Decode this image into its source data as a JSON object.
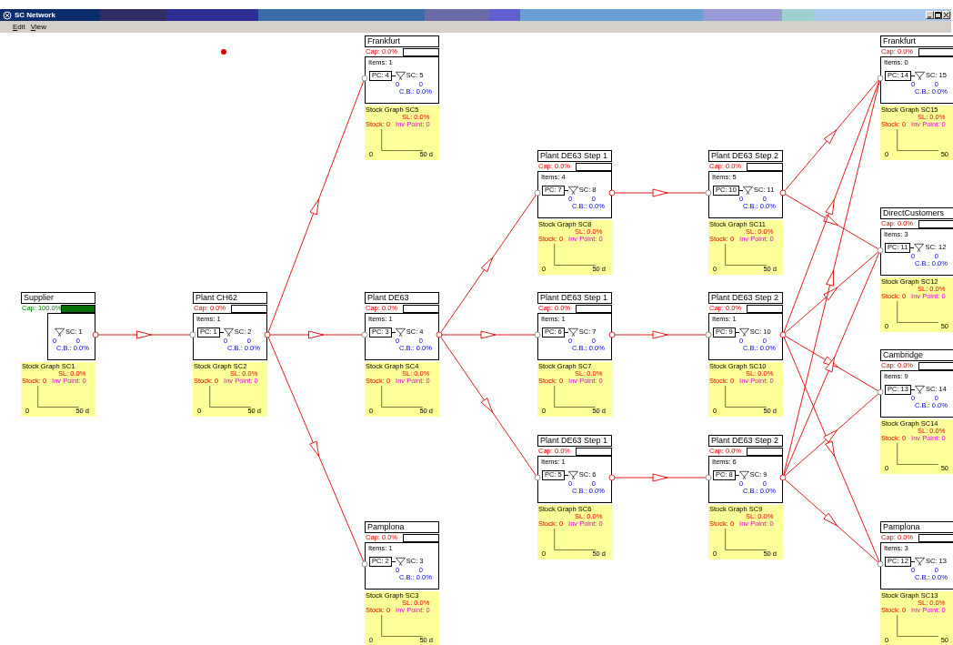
{
  "window": {
    "title": "SC Network"
  },
  "menu": [
    "Edit",
    "View"
  ],
  "nodes": [
    {
      "kind": "source",
      "title": "Supplier",
      "capacity": {
        "text": "Cap: 100.0%",
        "level": 1
      },
      "sc": "SC: 1",
      "sc_low": [
        "0",
        "0"
      ],
      "cbl": "C.B.: 0.0%",
      "graph": {
        "title": "Stock Graph SC1",
        "sl": "SL: 0.0%",
        "stock": "Stock: 0",
        "inv_point": "Inv Point: 0",
        "axis_min": "0",
        "axis_max": "50 d"
      }
    },
    {
      "kind": "site",
      "title": "Plant CH62",
      "capacity": {
        "text": "Cap: 0.0%",
        "level": 0
      },
      "items": "Items: 1",
      "pc": "PC: 1",
      "sc": "SC: 2",
      "sc_low": [
        "0",
        "0"
      ],
      "cbl": "C.B.: 0.0%",
      "graph": {
        "title": "Stock Graph SC2",
        "sl": "SL: 0.0%",
        "stock": "Stock: 0",
        "inv_point": "Inv Point: 0",
        "axis_min": "0",
        "axis_max": "50 d"
      }
    },
    {
      "kind": "site",
      "title": "Frankfurt",
      "capacity": {
        "text": "Cap: 0.0%",
        "level": 0
      },
      "items": "Items: 1",
      "pc": "PC: 4",
      "sc": "SC: 5",
      "sc_low": [
        "0",
        "0"
      ],
      "cbl": "C.B.: 0.0%",
      "graph": {
        "title": "Stock Graph SC5",
        "sl": "SL: 0.0%",
        "stock": "Stock: 0",
        "inv_point": "Inv Point: 0",
        "axis_min": "0",
        "axis_max": "50 d"
      }
    },
    {
      "kind": "site",
      "title": "Plant DE63",
      "capacity": {
        "text": "Cap: 0.0%",
        "level": 0
      },
      "items": "Items: 1",
      "pc": "PC: 3",
      "sc": "SC: 4",
      "sc_low": [
        "0",
        "0"
      ],
      "cbl": "C.B.: 0.0%",
      "graph": {
        "title": "Stock Graph SC4",
        "sl": "SL: 0.0%",
        "stock": "Stock: 0",
        "inv_point": "Inv Point: 0",
        "axis_min": "0",
        "axis_max": "50 d"
      }
    },
    {
      "kind": "site",
      "title": "Pamplona",
      "capacity": {
        "text": "Cap: 0.0%",
        "level": 0
      },
      "items": "Items: 1",
      "pc": "PC: 2",
      "sc": "SC: 3",
      "sc_low": [
        "0",
        "0"
      ],
      "cbl": "C.B.: 0.0%",
      "graph": {
        "title": "Stock Graph SC3",
        "sl": "SL: 0.0%",
        "stock": "Stock: 0",
        "inv_point": "Inv Point: 0",
        "axis_min": "0",
        "axis_max": "50 d"
      }
    },
    {
      "kind": "site",
      "title": "Plant DE63 Step 1",
      "capacity": {
        "text": "Cap: 0.0%",
        "level": 0
      },
      "items": "Items: 4",
      "pc": "PC: 7",
      "sc": "SC: 8",
      "sc_low": [
        "0",
        "0"
      ],
      "cbl": "C.B.: 0.0%",
      "graph": {
        "title": "Stock Graph SC8",
        "sl": "SL: 0.0%",
        "stock": "Stock: 0",
        "inv_point": "Inv Point: 0",
        "axis_min": "0",
        "axis_max": "50 d"
      }
    },
    {
      "kind": "site",
      "title": "Plant DE63 Step 1",
      "capacity": {
        "text": "Cap: 0.0%",
        "level": 0
      },
      "items": "Items: 1",
      "pc": "PC: 6",
      "sc": "SC: 7",
      "sc_low": [
        "0",
        "0"
      ],
      "cbl": "C.B.: 0.0%",
      "graph": {
        "title": "Stock Graph SC7",
        "sl": "SL: 0.0%",
        "stock": "Stock: 0",
        "inv_point": "Inv Point: 0",
        "axis_min": "0",
        "axis_max": "50 d"
      }
    },
    {
      "kind": "site",
      "title": "Plant DE63 Step 1",
      "capacity": {
        "text": "Cap: 0.0%",
        "level": 0
      },
      "items": "Items: 1",
      "pc": "PC: 5",
      "sc": "SC: 6",
      "sc_low": [
        "0",
        "0"
      ],
      "cbl": "C.B.: 0.0%",
      "graph": {
        "title": "Stock Graph SC6",
        "sl": "SL: 0.0%",
        "stock": "Stock: 0",
        "inv_point": "Inv Point: 0",
        "axis_min": "0",
        "axis_max": "50 d"
      }
    },
    {
      "kind": "site",
      "title": "Plant DE63 Step 2",
      "capacity": {
        "text": "Cap: 0.0%",
        "level": 0
      },
      "items": "Items: 5",
      "pc": "PC: 10",
      "sc": "SC: 11",
      "sc_low": [
        "0",
        "0"
      ],
      "cbl": "C.B.: 0.0%",
      "graph": {
        "title": "Stock Graph SC11",
        "sl": "SL: 0.0%",
        "stock": "Stock: 0",
        "inv_point": "Inv Point: 0",
        "axis_min": "0",
        "axis_max": "50 d"
      }
    },
    {
      "kind": "site",
      "title": "Plant DE63 Step 2",
      "capacity": {
        "text": "Cap: 0.0%",
        "level": 0
      },
      "items": "Items: 1",
      "pc": "PC: 9",
      "sc": "SC: 10",
      "sc_low": [
        "0",
        "0"
      ],
      "cbl": "C.B.: 0.0%",
      "graph": {
        "title": "Stock Graph SC10",
        "sl": "SL: 0.0%",
        "stock": "Stock: 0",
        "inv_point": "Inv Point: 0",
        "axis_min": "0",
        "axis_max": "50 d"
      }
    },
    {
      "kind": "site",
      "title": "Plant DE63 Step 2",
      "capacity": {
        "text": "Cap: 0.0%",
        "level": 0
      },
      "items": "Items: 6",
      "pc": "PC: 8",
      "sc": "SC: 9",
      "sc_low": [
        "0",
        "0"
      ],
      "cbl": "C.B.: 0.0%",
      "graph": {
        "title": "Stock Graph SC9",
        "sl": "SL: 0.0%",
        "stock": "Stock: 0",
        "inv_point": "Inv Point: 0",
        "axis_min": "0",
        "axis_max": "50 d"
      }
    },
    {
      "kind": "site",
      "title": "Frankfurt",
      "capacity": {
        "text": "Cap: 0.0%",
        "level": 0
      },
      "items": "Items: 0",
      "pc": "PC: 14",
      "sc": "SC: 15",
      "sc_low": [
        "0",
        "0"
      ],
      "cbl": "C.B.: 0.0%",
      "graph": {
        "title": "Stock Graph SC15",
        "sl": "SL: 0.0%",
        "stock": "Stock: 0",
        "inv_point": "Inv Point: 0",
        "axis_min": "0",
        "axis_max": "50"
      }
    },
    {
      "kind": "site",
      "title": "DirectCustomers",
      "capacity": {
        "text": "Cap: 0.0%",
        "level": 0
      },
      "items": "Items: 3",
      "pc": "PC: 11",
      "sc": "SC: 12",
      "sc_low": [
        "0",
        "0"
      ],
      "cbl": "C.B.: 0.0%",
      "graph": {
        "title": "Stock Graph SC12",
        "sl": "SL: 0.0%",
        "stock": "Stock: 0",
        "inv_point": "Inv Point: 0",
        "axis_min": "0",
        "axis_max": "50"
      }
    },
    {
      "kind": "site",
      "title": "Cambridge",
      "capacity": {
        "text": "Cap: 0.0%",
        "level": 0
      },
      "items": "Items: 9",
      "pc": "PC: 13",
      "sc": "SC: 14",
      "sc_low": [
        "0",
        "0"
      ],
      "cbl": "C.B.: 0.0%",
      "graph": {
        "title": "Stock Graph SC14",
        "sl": "SL: 0.0%",
        "stock": "Stock: 0",
        "inv_point": "Inv Point: 0",
        "axis_min": "0",
        "axis_max": "50"
      }
    },
    {
      "kind": "site",
      "title": "Pamplona",
      "capacity": {
        "text": "Cap: 0.0%",
        "level": 0
      },
      "items": "Items: 3",
      "pc": "PC: 12",
      "sc": "SC: 13",
      "sc_low": [
        "0",
        "0"
      ],
      "cbl": "C.B.: 0.0%",
      "graph": {
        "title": "Stock Graph SC13",
        "sl": "SL: 0.0%",
        "stock": "Stock: 0",
        "inv_point": "Inv Point: 0",
        "axis_min": "0",
        "axis_max": "50"
      }
    }
  ]
}
